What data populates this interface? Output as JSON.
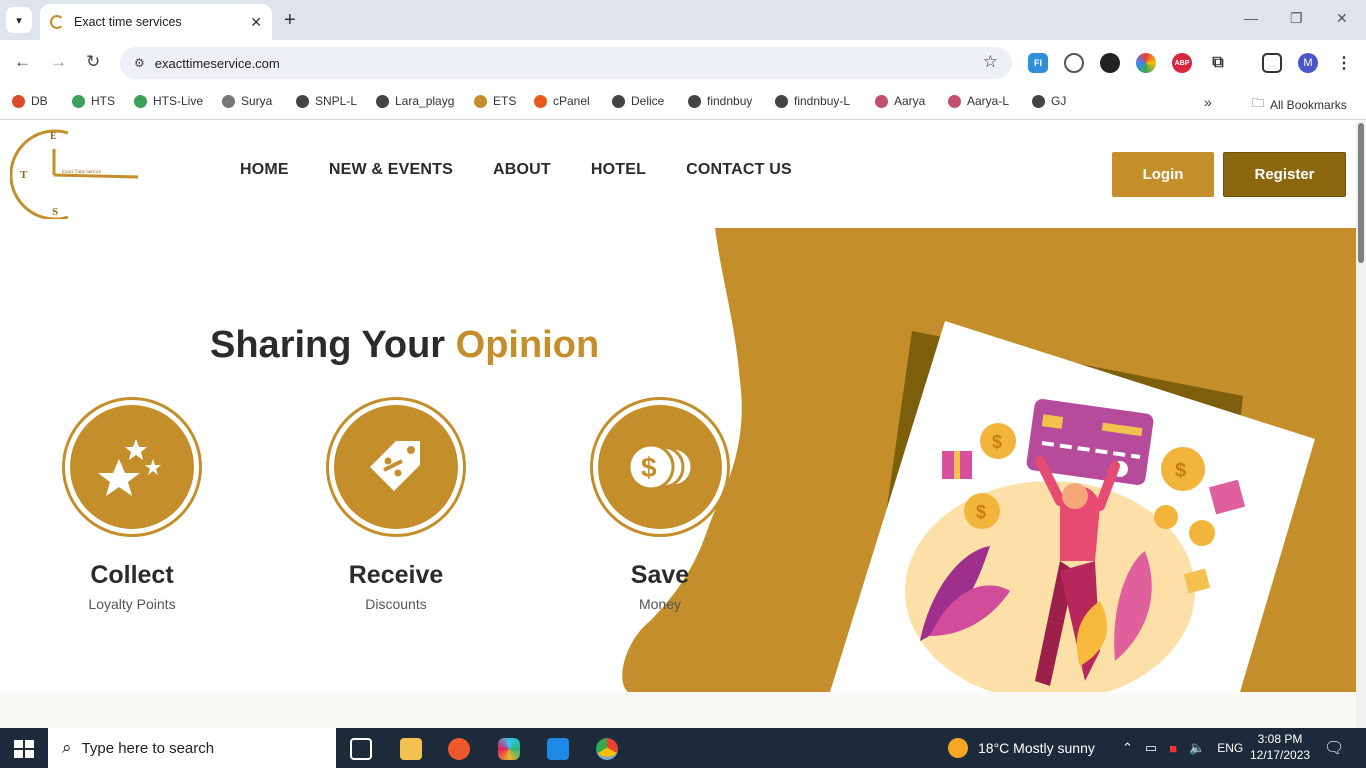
{
  "browser": {
    "tab_title": "Exact time services",
    "url": "exacttimeservice.com",
    "bookmarks": [
      "DB",
      "HTS",
      "HTS-Live",
      "Surya",
      "SNPL-L",
      "Lara_playg",
      "ETS",
      "cPanel",
      "Delice",
      "findnbuy",
      "findnbuy-L",
      "Aarya",
      "Aarya-L",
      "GJ"
    ],
    "all_bookmarks": "All Bookmarks",
    "profile_initial": "M",
    "ext_labels": {
      "fi": "FI",
      "abp": "ABP"
    }
  },
  "site": {
    "logo_text": "Exact Time Service",
    "logo_letters": {
      "e": "E",
      "t": "T",
      "s": "S"
    },
    "nav": [
      "HOME",
      "NEW & EVENTS",
      "ABOUT",
      "HOTEL",
      "CONTACT US"
    ],
    "login": "Login",
    "register": "Register",
    "headline": "Sharing Your ",
    "headline_accent": "Opinion",
    "features": [
      {
        "title": "Collect",
        "subtitle": "Loyalty Points",
        "icon": "stars-icon"
      },
      {
        "title": "Receive",
        "subtitle": "Discounts",
        "icon": "discount-tag-icon"
      },
      {
        "title": "Save",
        "subtitle": "Money",
        "icon": "coins-icon"
      }
    ],
    "colors": {
      "accent": "#c48f2b",
      "dark_accent": "#8c6710"
    }
  },
  "taskbar": {
    "search_placeholder": "Type here to search",
    "weather": "18°C  Mostly sunny",
    "language": "ENG",
    "time": "3:08 PM",
    "date": "12/17/2023"
  }
}
